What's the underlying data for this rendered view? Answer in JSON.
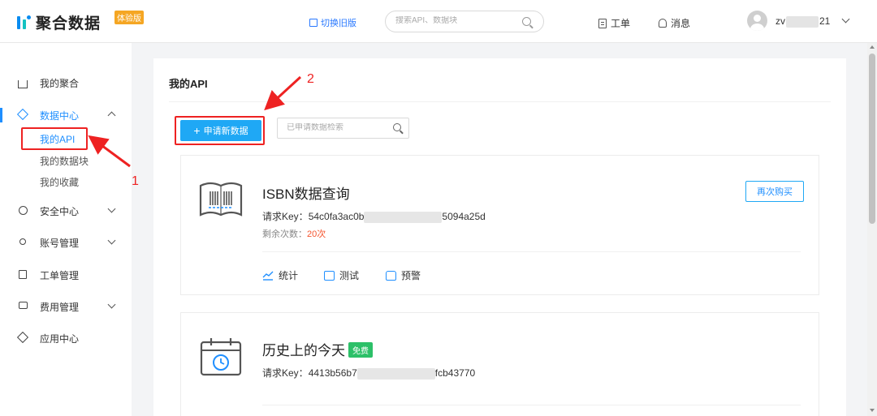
{
  "header": {
    "logo_text": "聚合数据",
    "logo_badge": "体验版",
    "switch_old": "切换旧版",
    "search_placeholder": "搜索API、数据块",
    "ticket_label": "工单",
    "message_label": "消息",
    "username_start": "zv",
    "username_end": "21"
  },
  "sidebar": {
    "items": [
      {
        "label": "我的聚合"
      },
      {
        "label": "数据中心"
      },
      {
        "label": "安全中心"
      },
      {
        "label": "账号管理"
      },
      {
        "label": "工单管理"
      },
      {
        "label": "费用管理"
      },
      {
        "label": "应用中心"
      }
    ],
    "sub_items": [
      {
        "label": "我的API"
      },
      {
        "label": "我的数据块"
      },
      {
        "label": "我的收藏"
      }
    ]
  },
  "main": {
    "title": "我的API",
    "apply_button": "申请新数据",
    "search_placeholder": "已申请数据检索",
    "cards": [
      {
        "title": "ISBN数据查询",
        "key_label": "请求Key：",
        "key_start": "54c0fa3ac0b",
        "key_end": "5094a25d",
        "remain_label": "剩余次数：",
        "remain_value": "20次",
        "rebuy_button": "再次购买",
        "actions": [
          "统计",
          "测试",
          "预警"
        ]
      },
      {
        "title": "历史上的今天",
        "badge": "免费",
        "key_label": "请求Key：",
        "key_start": "4413b56b7",
        "key_end": "fcb43770"
      }
    ]
  },
  "annotations": {
    "label1": "1",
    "label2": "2",
    "color": "#e22222"
  },
  "colors": {
    "accent": "#1f8fff",
    "primary_button": "#1fa8f5",
    "warning": "#f5542e",
    "free_badge": "#2cc068",
    "beta_badge": "#f5a623"
  }
}
